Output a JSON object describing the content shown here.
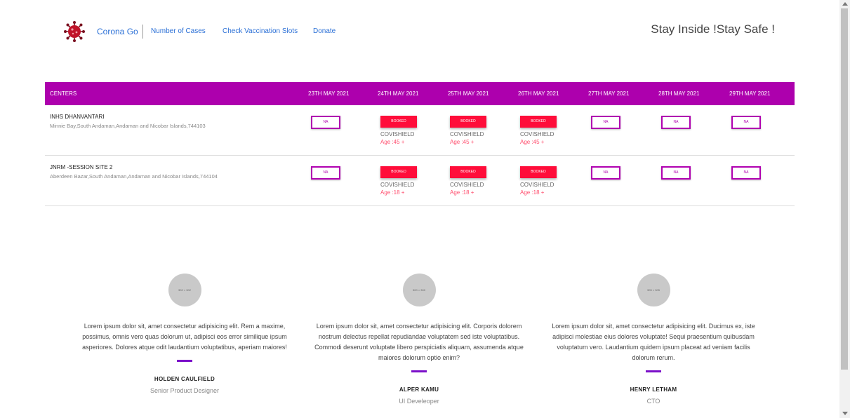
{
  "header": {
    "brand": "Corona Go",
    "nav": [
      "Number of Cases",
      "Check Vaccination Slots",
      "Donate"
    ],
    "tagline": "Stay Inside !Stay Safe !"
  },
  "table": {
    "header_label": "CENTERS",
    "dates": [
      "23TH MAY 2021",
      "24TH MAY 2021",
      "25TH MAY 2021",
      "26TH MAY 2021",
      "27TH MAY 2021",
      "28TH MAY 2021",
      "29TH MAY 2021"
    ],
    "rows": [
      {
        "name": "INHS DHANVANTARI",
        "address": "Minnie Bay,South Andaman,Andaman and Nicobar Islands,744103",
        "slots": [
          {
            "status": "NA"
          },
          {
            "status": "BOOKED",
            "vaccine": "COVISHIELD",
            "age": "Age :45 +"
          },
          {
            "status": "BOOKED",
            "vaccine": "COVISHIELD",
            "age": "Age :45 +"
          },
          {
            "status": "BOOKED",
            "vaccine": "COVISHIELD",
            "age": "Age :45 +"
          },
          {
            "status": "NA"
          },
          {
            "status": "NA"
          },
          {
            "status": "NA"
          }
        ]
      },
      {
        "name": "JNRM -SESSION SITE 2",
        "address": "Aberdeen Bazar,South Andaman,Andaman and Nicobar Islands,744104",
        "slots": [
          {
            "status": "NA"
          },
          {
            "status": "BOOKED",
            "vaccine": "COVISHIELD",
            "age": "Age :18 +"
          },
          {
            "status": "BOOKED",
            "vaccine": "COVISHIELD",
            "age": "Age :18 +"
          },
          {
            "status": "BOOKED",
            "vaccine": "COVISHIELD",
            "age": "Age :18 +"
          },
          {
            "status": "NA"
          },
          {
            "status": "NA"
          },
          {
            "status": "NA"
          }
        ]
      }
    ]
  },
  "team": [
    {
      "avatar_text": "302 × 302",
      "quote": "Lorem ipsum dolor sit, amet consectetur adipisicing elit. Rem a maxime, possimus, omnis vero quas dolorum ut, adipisci eos error similique ipsum asperiores. Dolores atque odit laudantium voluptatibus, aperiam maiores!",
      "name": "HOLDEN CAULFIELD",
      "role": "Senior Product Designer"
    },
    {
      "avatar_text": "300 × 300",
      "quote": "Lorem ipsum dolor sit, amet consectetur adipisicing elit. Corporis dolorem nostrum delectus repellat repudiandae voluptatem sed iste voluptatibus. Commodi deserunt voluptate libero perspiciatis aliquam, assumenda atque maiores dolorum optio enim?",
      "name": "ALPER KAMU",
      "role": "UI Develeoper"
    },
    {
      "avatar_text": "305 × 305",
      "quote": "Lorem ipsum dolor sit, amet consectetur adipisicing elit. Ducimus ex, iste adipisci molestiae eius dolores voluptate! Sequi praesentium quibusdam voluptatum vero. Laudantium quidem ipsum placeat ad veniam facilis dolorum rerum.",
      "name": "HENRY LETHAM",
      "role": "CTO"
    }
  ],
  "colors": {
    "table_header": "#ad00ad",
    "booked": "#ff0d3a",
    "na_border": "#b000b0",
    "link": "#2a6fd6",
    "accent_bar": "#7b10c9"
  }
}
